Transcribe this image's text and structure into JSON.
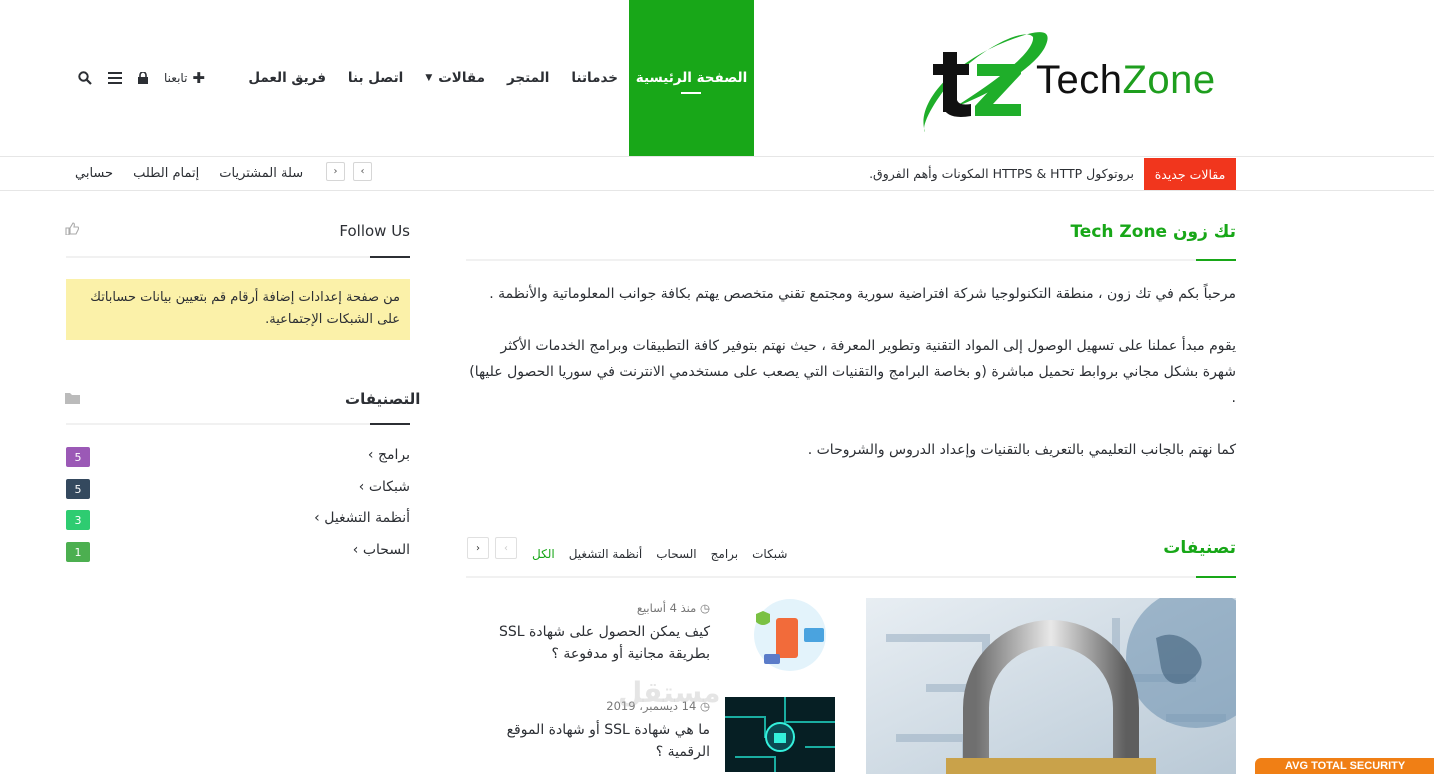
{
  "logo": {
    "word1": "Tech",
    "word2": "Zone",
    "brand_green": "#1e9e1e"
  },
  "nav": {
    "items": [
      {
        "label": "الصفحة الرئيسية",
        "active": true
      },
      {
        "label": "خدماتنا"
      },
      {
        "label": "المتجر"
      },
      {
        "label": "مقالات",
        "has_dropdown": true
      },
      {
        "label": "اتصل بنا"
      },
      {
        "label": "فريق العمل"
      }
    ],
    "follow_label": "تابعنا",
    "active_color": "#18a718"
  },
  "topbar": {
    "breaking_label": "مقالات جديدة",
    "breaking_text": "بروتوكول HTTPS & HTTP المكونات وأهم الفروق.",
    "links": [
      "حسابي",
      "إتمام الطلب",
      "سلة المشتريات"
    ]
  },
  "about": {
    "title": "تك زون Tech Zone",
    "paragraphs": [
      "مرحباً بكم في تك زون ، منطقة التكنولوجيا شركة افتراضية سورية ومجتمع تقني متخصص يهتم بكافة جوانب المعلوماتية والأنظمة .",
      "يقوم مبدأ عملنا على تسهيل الوصول إلى المواد التقنية وتطوير المعرفة ، حيث نهتم بتوفير كافة التطبيقات وبرامج الخدمات الأكثر شهرة بشكل مجاني بروابط تحميل مباشرة (و بخاصة البرامج والتقنيات التي يصعب على مستخدمي الانترنت في سوريا الحصول عليها) .",
      "كما نهتم بالجانب التعليمي بالتعريف بالتقنيات وإعداد الدروس والشروحات ."
    ]
  },
  "categories_block": {
    "title": "تصنيفات",
    "filters": [
      "الكل",
      "أنظمة التشغيل",
      "السحاب",
      "برامج",
      "شبكات"
    ],
    "posts": [
      {
        "date": "منذ 4 أسابيع",
        "title": "كيف يمكن الحصول على شهادة SSL بطريقة مجانية أو مدفوعة ؟"
      },
      {
        "date": "14 ديسمبر، 2019",
        "title": "ما هي شهادة SSL أو شهادة الموقع الرقمية ؟"
      }
    ]
  },
  "sidebar": {
    "follow_title": "Follow Us",
    "follow_notice": "من صفحة إعدادات إضافة أرقام قم بتعيين بيانات حساباتك على الشبكات الإجتماعية.",
    "cats_title": "التصنيفات",
    "cats": [
      {
        "name": "برامج",
        "count": "5",
        "color": "#9b59b6"
      },
      {
        "name": "شبكات",
        "count": "5",
        "color": "#34495e"
      },
      {
        "name": "أنظمة التشغيل",
        "count": "3",
        "color": "#2ecc71"
      },
      {
        "name": "السحاب",
        "count": "1",
        "color": "#4caf50"
      }
    ]
  },
  "footer": {
    "avast_text": "AVG TOTAL SECURITY",
    "watermark": "مستقل"
  }
}
